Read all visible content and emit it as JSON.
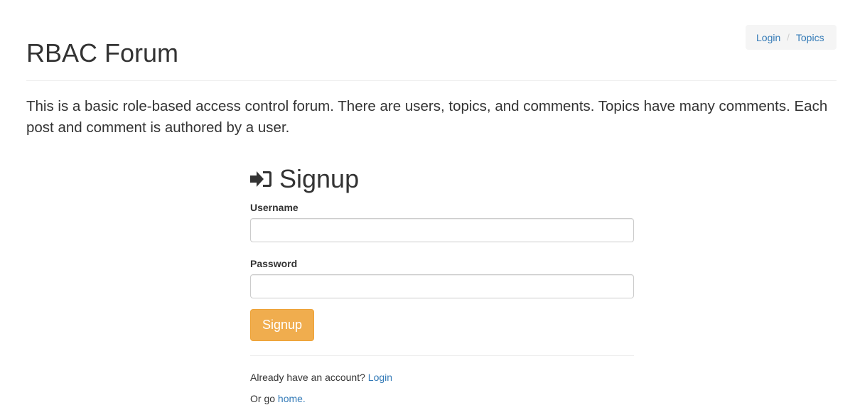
{
  "breadcrumb": {
    "items": [
      {
        "label": "Login"
      },
      {
        "label": "Topics"
      }
    ],
    "separator": "/"
  },
  "header": {
    "title": "RBAC Forum"
  },
  "intro": {
    "text": "This is a basic role-based access control forum. There are users, topics, and comments. Topics have many comments. Each post and comment is authored by a user."
  },
  "signup_form": {
    "icon": "sign-in-icon",
    "title": "Signup",
    "username_label": "Username",
    "username_value": "",
    "password_label": "Password",
    "password_value": "",
    "submit_label": "Signup"
  },
  "footer_links": {
    "account_prompt": "Already have an account?",
    "login_link": "Login",
    "go_prefix": "Or go",
    "home_link": "home."
  },
  "colors": {
    "link": "#337ab7",
    "warning_button": "#f0ad4e",
    "text": "#333333"
  }
}
